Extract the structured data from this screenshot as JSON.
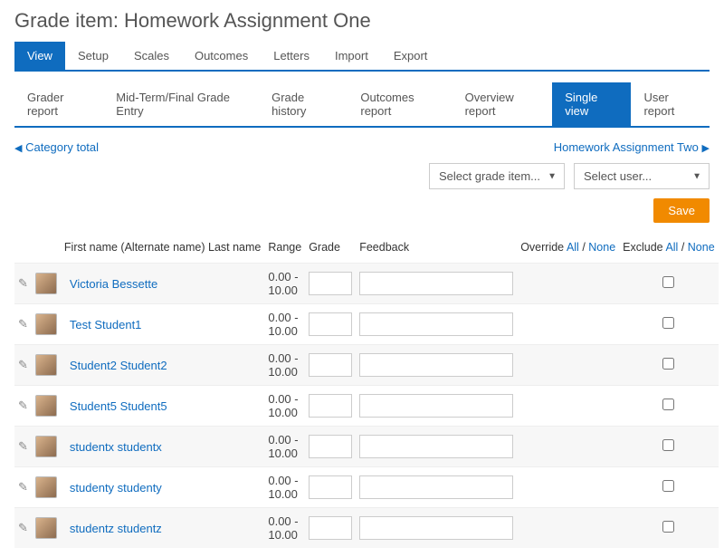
{
  "page_title": "Grade item: Homework Assignment One",
  "primary_tabs": [
    "View",
    "Setup",
    "Scales",
    "Outcomes",
    "Letters",
    "Import",
    "Export"
  ],
  "primary_active": 0,
  "secondary_tabs": [
    "Grader report",
    "Mid-Term/Final Grade Entry",
    "Grade history",
    "Outcomes report",
    "Overview report",
    "Single view",
    "User report"
  ],
  "secondary_active": 5,
  "nav": {
    "prev": "Category total",
    "next": "Homework Assignment Two"
  },
  "selects": {
    "grade_item": "Select grade item...",
    "user": "Select user..."
  },
  "save_label": "Save",
  "headers": {
    "name": "First name (Alternate name) Last name",
    "range": "Range",
    "grade": "Grade",
    "feedback": "Feedback",
    "override_label": "Override",
    "exclude_label": "Exclude",
    "all": "All",
    "none": "None",
    "sep": " / "
  },
  "students": [
    {
      "name": "Victoria Bessette",
      "range": "0.00 - 10.00",
      "grade": "",
      "feedback": "",
      "excluded": false
    },
    {
      "name": "Test Student1",
      "range": "0.00 - 10.00",
      "grade": "",
      "feedback": "",
      "excluded": false
    },
    {
      "name": "Student2 Student2",
      "range": "0.00 - 10.00",
      "grade": "",
      "feedback": "",
      "excluded": false
    },
    {
      "name": "Student5 Student5",
      "range": "0.00 - 10.00",
      "grade": "",
      "feedback": "",
      "excluded": false
    },
    {
      "name": "studentx studentx",
      "range": "0.00 - 10.00",
      "grade": "",
      "feedback": "",
      "excluded": false
    },
    {
      "name": "studenty studenty",
      "range": "0.00 - 10.00",
      "grade": "",
      "feedback": "",
      "excluded": false
    },
    {
      "name": "studentz studentz",
      "range": "0.00 - 10.00",
      "grade": "",
      "feedback": "",
      "excluded": false
    }
  ]
}
